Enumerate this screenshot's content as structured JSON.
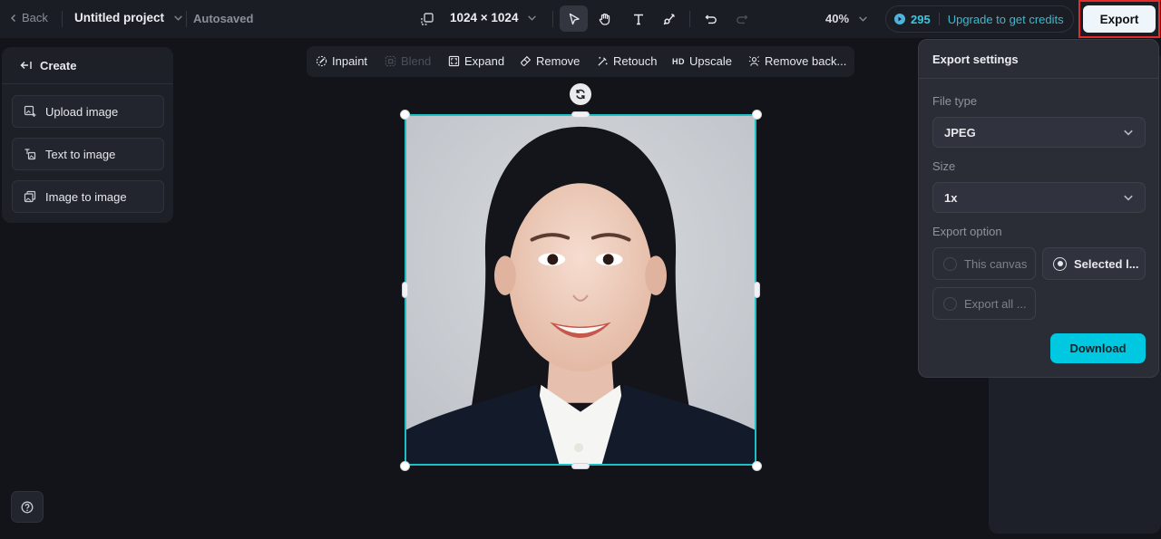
{
  "topbar": {
    "back_label": "Back",
    "project_title": "Untitled project",
    "save_status": "Autosaved",
    "canvas_size": "1024 × 1024",
    "tools": [
      {
        "name": "select",
        "icon": "cursor-arrow-icon",
        "active": true
      },
      {
        "name": "hand",
        "icon": "hand-icon",
        "active": false
      },
      {
        "name": "text",
        "icon": "text-icon",
        "active": false
      },
      {
        "name": "brush",
        "icon": "brush-icon",
        "active": false
      }
    ],
    "undo_icon": "undo-icon",
    "redo_icon": "redo-icon",
    "zoom_level": "40%",
    "credits_count": "295",
    "upgrade_label": "Upgrade to get credits",
    "export_label": "Export"
  },
  "create_panel": {
    "header": "Create",
    "items": [
      {
        "label": "Upload image",
        "icon": "upload-image-icon"
      },
      {
        "label": "Text to image",
        "icon": "text-to-image-icon"
      },
      {
        "label": "Image to image",
        "icon": "image-to-image-icon"
      }
    ]
  },
  "edit_toolbar": {
    "items": [
      {
        "label": "Inpaint",
        "icon": "inpaint-icon",
        "disabled": false
      },
      {
        "label": "Blend",
        "icon": "blend-icon",
        "disabled": true
      },
      {
        "label": "Expand",
        "icon": "expand-icon",
        "disabled": false
      },
      {
        "label": "Remove",
        "icon": "eraser-icon",
        "disabled": false
      },
      {
        "label": "Retouch",
        "icon": "retouch-wand-icon",
        "disabled": false
      },
      {
        "label": "Upscale",
        "icon": "hd-icon",
        "badge": "HD",
        "disabled": false
      },
      {
        "label": "Remove back...",
        "icon": "remove-background-icon",
        "disabled": false
      }
    ]
  },
  "canvas": {
    "image_description": "Portrait of a smiling woman with long black hair in a navy blazer and white shirt on grey background",
    "selection_color": "#1fc0c4"
  },
  "export_settings": {
    "title": "Export settings",
    "file_type_label": "File type",
    "file_type_value": "JPEG",
    "size_label": "Size",
    "size_value": "1x",
    "export_option_label": "Export option",
    "options": [
      {
        "label": "This canvas",
        "selected": false
      },
      {
        "label": "Selected l...",
        "selected": true
      },
      {
        "label": "Export all ...",
        "selected": false
      }
    ],
    "download_label": "Download"
  },
  "colors": {
    "accent": "#00c8e0",
    "credits": "#3dc6e0",
    "highlight_border": "#e52a2a"
  }
}
